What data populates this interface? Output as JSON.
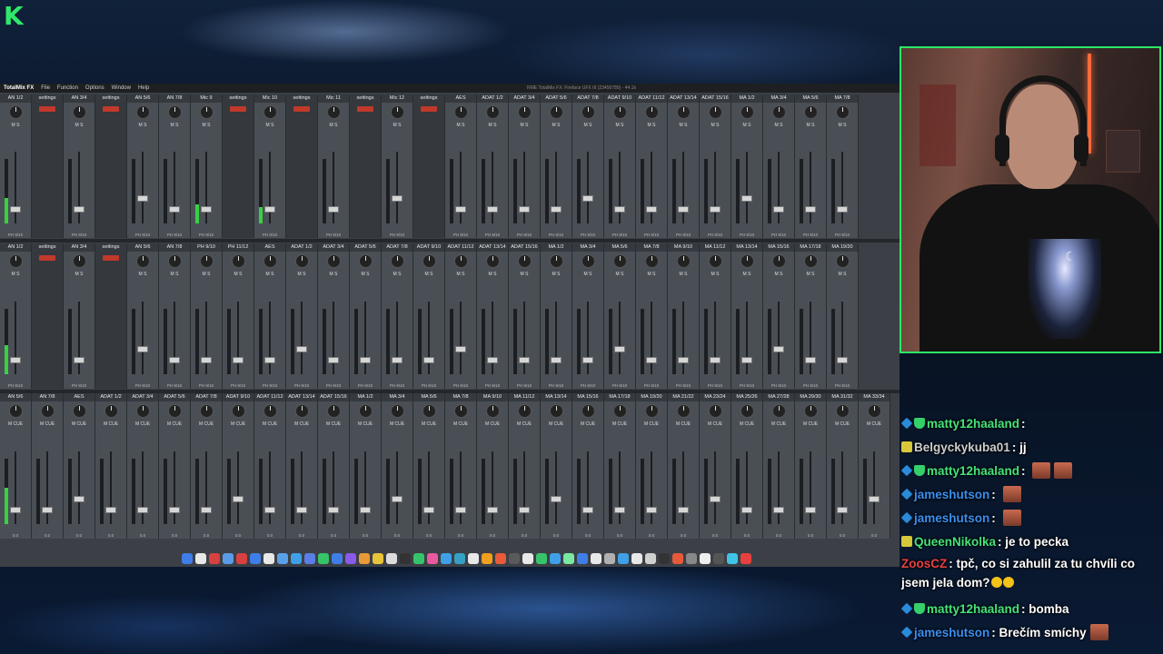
{
  "overlay": {
    "logo_letter": "K"
  },
  "app": {
    "menu": [
      "TotalMix FX",
      "File",
      "Function",
      "Options",
      "Window",
      "Help"
    ],
    "window_title": "RME TotalMix FX: Fireface UFX III (23456789) - 44.1k",
    "row1_channels": [
      "AN 1/2",
      "AN 3/4",
      "AN 5/6",
      "AN 7/8",
      "Mic 9",
      "Mic 10",
      "Mic 11",
      "Mic 12",
      "AES",
      "ADAT 1/2",
      "ADAT 3/4",
      "ADAT 5/6",
      "ADAT 7/8",
      "ADAT 9/10",
      "ADAT 11/12",
      "ADAT 13/14",
      "ADAT 15/16",
      "MA 1/2",
      "MA 3/4",
      "MA 5/6",
      "MA 7/8"
    ],
    "row2_channels": [
      "AN 1/2",
      "AN 3/4",
      "AN 5/6",
      "AN 7/8",
      "PH 9/10",
      "PH 11/12",
      "AES",
      "ADAT 1/2",
      "ADAT 3/4",
      "ADAT 5/6",
      "ADAT 7/8",
      "ADAT 9/10",
      "ADAT 11/12",
      "ADAT 13/14",
      "ADAT 15/16",
      "MA 1/2",
      "MA 3/4",
      "MA 5/6",
      "MA 7/8",
      "MA 9/10",
      "MA 11/12",
      "MA 13/14",
      "MA 15/16",
      "MA 17/18",
      "MA 19/20"
    ],
    "row3_channels": [
      "AN 5/6",
      "AN 7/8",
      "AES",
      "ADAT 1/2",
      "ADAT 3/4",
      "ADAT 5/6",
      "ADAT 7/8",
      "ADAT 9/10",
      "ADAT 11/12",
      "ADAT 13/14",
      "ADAT 15/16",
      "MA 1/2",
      "MA 3/4",
      "MA 5/6",
      "MA 7/8",
      "MA 9/10",
      "MA 11/12",
      "MA 13/14",
      "MA 15/16",
      "MA 17/18",
      "MA 19/20",
      "MA 21/22",
      "MA 23/24",
      "MA 25/26",
      "MA 27/28",
      "MA 29/30",
      "MA 31/32",
      "MA 33/34"
    ],
    "settings_label": "settings",
    "mute_label": "M",
    "solo_label": "S",
    "cue_label": "CUE",
    "fader_value": "0.0"
  },
  "dock": {
    "icon_colors": [
      "#3f7ee8",
      "#e8e8e8",
      "#d94040",
      "#5a9be8",
      "#d94040",
      "#3f7ee8",
      "#e8e8e8",
      "#5aa0e8",
      "#3fa0e8",
      "#5a7ee8",
      "#36c46a",
      "#3f7ee8",
      "#8a5ae8",
      "#e89a3a",
      "#e8c43a",
      "#ddd",
      "#333",
      "#36c46a",
      "#e85aa0",
      "#3fa0e8",
      "#36a0c4",
      "#e8e8e8",
      "#f0a020",
      "#e85a3a",
      "#5a5a5a",
      "#e8e8e8",
      "#36c46a",
      "#3fa0e8",
      "#7ae8a0",
      "#3f7ee8",
      "#e8e8e8",
      "#b0b0b0",
      "#3fa0e8",
      "#e8e8e8",
      "#d0d0d0",
      "#333",
      "#e85a3a",
      "#888",
      "#eee",
      "#555",
      "#3fc4e8",
      "#e84040"
    ]
  },
  "chat": {
    "messages": [
      {
        "user": "matty12haaland",
        "user_color": "#45e37a",
        "badges": [
          "sub",
          "vip"
        ],
        "text": "",
        "emotes": 0
      },
      {
        "user": "Belgyckykuba01",
        "user_color": "#cccccc",
        "badges": [
          "gift"
        ],
        "text": "jj",
        "emotes": 0
      },
      {
        "user": "matty12haaland",
        "user_color": "#45e37a",
        "badges": [
          "sub",
          "vip"
        ],
        "text": "",
        "emotes": 2
      },
      {
        "user": "jameshutson",
        "user_color": "#3a8ff0",
        "badges": [
          "sub"
        ],
        "text": "",
        "emotes": 1
      },
      {
        "user": "jameshutson",
        "user_color": "#3a8ff0",
        "badges": [
          "sub"
        ],
        "text": "",
        "emotes": 1
      },
      {
        "user": "QueenNikolka",
        "user_color": "#45e37a",
        "badges": [
          "gift"
        ],
        "text": "je to pecka",
        "emotes": 0
      },
      {
        "user": "ZoosCZ",
        "user_color": "#e84040",
        "badges": [],
        "text": "tpč, co si zahulil za tu chvíli co jsem jela dom?",
        "emotes": 0,
        "emoji": 2
      },
      {
        "user": "matty12haaland",
        "user_color": "#45e37a",
        "badges": [
          "sub",
          "vip"
        ],
        "text": "bomba",
        "emotes": 0
      },
      {
        "user": "jameshutson",
        "user_color": "#3a8ff0",
        "badges": [
          "sub"
        ],
        "text": "Brečím smíchy",
        "emotes": 1
      }
    ]
  }
}
